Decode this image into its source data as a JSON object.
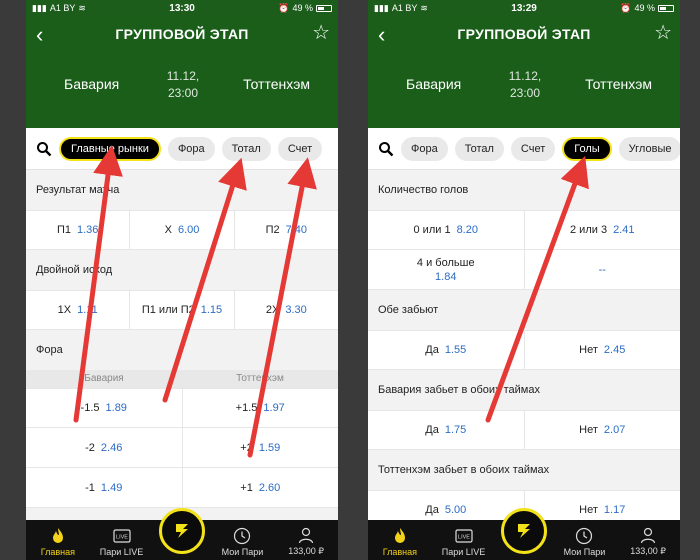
{
  "status": {
    "carrier": "A1 BY",
    "time_left": "13:30",
    "time_right": "13:29",
    "battery": "49 %"
  },
  "header": {
    "title": "ГРУППОВОЙ ЭТАП",
    "team_home": "Бавария",
    "team_away": "Тоттенхэм",
    "date": "11.12,",
    "time": "23:00"
  },
  "left": {
    "pills": [
      "Главные рынки",
      "Фора",
      "Тотал",
      "Счет"
    ],
    "result": {
      "title": "Результат матча",
      "cells": [
        {
          "label": "П1",
          "value": "1.36"
        },
        {
          "label": "X",
          "value": "6.00"
        },
        {
          "label": "П2",
          "value": "7.40"
        }
      ]
    },
    "double": {
      "title": "Двойной исход",
      "cells": [
        {
          "label": "1X",
          "value": "1.11"
        },
        {
          "label": "П1 или П2",
          "value": "1.15"
        },
        {
          "label": "2X",
          "value": "3.30"
        }
      ]
    },
    "fora": {
      "title": "Фора",
      "home": "Бавария",
      "away": "Тоттенхэм",
      "rows": [
        [
          {
            "label": "-1.5",
            "value": "1.89"
          },
          {
            "label": "+1.5",
            "value": "1.97"
          }
        ],
        [
          {
            "label": "-2",
            "value": "2.46"
          },
          {
            "label": "+2",
            "value": "1.59"
          }
        ],
        [
          {
            "label": "-1",
            "value": "1.49"
          },
          {
            "label": "+1",
            "value": "2.60"
          }
        ]
      ]
    }
  },
  "right": {
    "pills": [
      "Фора",
      "Тотал",
      "Счет",
      "Голы",
      "Угловые"
    ],
    "goals": {
      "title": "Количество голов",
      "row1": [
        {
          "label": "0 или 1",
          "value": "8.20"
        },
        {
          "label": "2 или 3",
          "value": "2.41"
        }
      ],
      "row2": [
        {
          "label": "4 и больше",
          "value": "1.84"
        },
        {
          "label": "",
          "value": "--"
        }
      ]
    },
    "both": {
      "title": "Обе забьют",
      "cells": [
        {
          "label": "Да",
          "value": "1.55"
        },
        {
          "label": "Нет",
          "value": "2.45"
        }
      ]
    },
    "bav": {
      "title": "Бавария забьет в обоих таймах",
      "cells": [
        {
          "label": "Да",
          "value": "1.75"
        },
        {
          "label": "Нет",
          "value": "2.07"
        }
      ]
    },
    "tot": {
      "title": "Тоттенхэм забьет в обоих таймах",
      "cells": [
        {
          "label": "Да",
          "value": "5.00"
        },
        {
          "label": "Нет",
          "value": "1.17"
        }
      ]
    }
  },
  "tabs": {
    "home": "Главная",
    "live": "Пари LIVE",
    "my": "Мои Пари",
    "balance": "133,00 ₽",
    "live_icon": "LIVE"
  },
  "colors": {
    "header_green": "#1a5e1a",
    "accent_yellow": "#f3e11a",
    "odds_blue": "#2b6cc4",
    "arrow_red": "#e53935"
  }
}
